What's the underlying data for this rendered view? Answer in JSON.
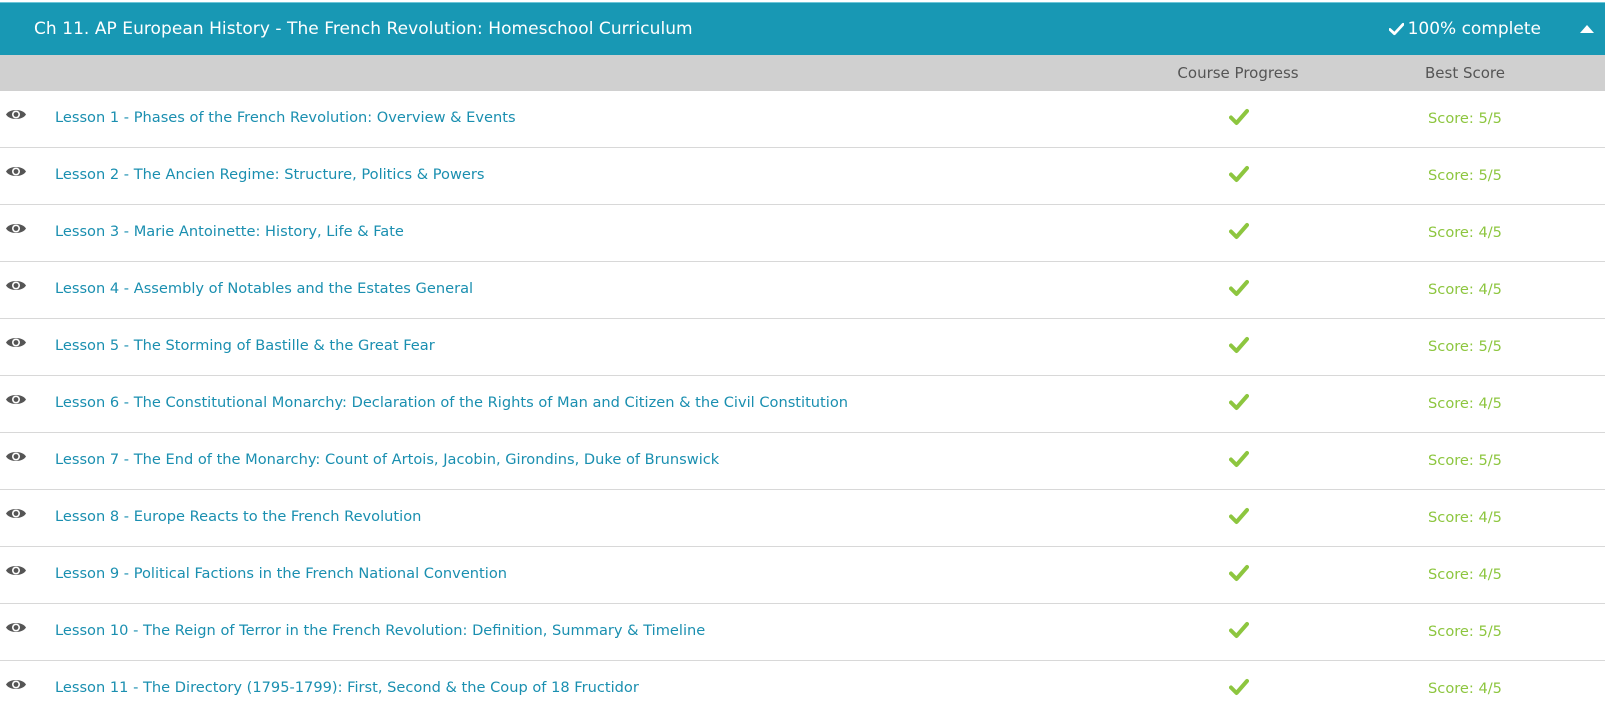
{
  "chapter": {
    "title": "Ch 11. AP European History - The French Revolution: Homeschool Curriculum",
    "completion": "100% complete",
    "collapse_icon": "caret-up-icon"
  },
  "columns": {
    "progress": "Course Progress",
    "score": "Best Score"
  },
  "colors": {
    "header_bg": "#1898b4",
    "link": "#1a8fb0",
    "success": "#8dc63f",
    "column_header_bg": "#d0d0d0"
  },
  "lessons": [
    {
      "title": "Lesson 1 - Phases of the French Revolution: Overview & Events",
      "completed": true,
      "score": "Score: 5/5"
    },
    {
      "title": "Lesson 2 - The Ancien Regime: Structure, Politics & Powers",
      "completed": true,
      "score": "Score: 5/5"
    },
    {
      "title": "Lesson 3 - Marie Antoinette: History, Life & Fate",
      "completed": true,
      "score": "Score: 4/5"
    },
    {
      "title": "Lesson 4 - Assembly of Notables and the Estates General",
      "completed": true,
      "score": "Score: 4/5"
    },
    {
      "title": "Lesson 5 - The Storming of Bastille & the Great Fear",
      "completed": true,
      "score": "Score: 5/5"
    },
    {
      "title": "Lesson 6 - The Constitutional Monarchy: Declaration of the Rights of Man and Citizen & the Civil Constitution",
      "completed": true,
      "score": "Score: 4/5"
    },
    {
      "title": "Lesson 7 - The End of the Monarchy: Count of Artois, Jacobin, Girondins, Duke of Brunswick",
      "completed": true,
      "score": "Score: 5/5"
    },
    {
      "title": "Lesson 8 - Europe Reacts to the French Revolution",
      "completed": true,
      "score": "Score: 4/5"
    },
    {
      "title": "Lesson 9 - Political Factions in the French National Convention",
      "completed": true,
      "score": "Score: 4/5"
    },
    {
      "title": "Lesson 10 - The Reign of Terror in the French Revolution: Definition, Summary & Timeline",
      "completed": true,
      "score": "Score: 5/5"
    },
    {
      "title": "Lesson 11 - The Directory (1795-1799): First, Second & the Coup of 18 Fructidor",
      "completed": true,
      "score": "Score: 4/5"
    }
  ]
}
